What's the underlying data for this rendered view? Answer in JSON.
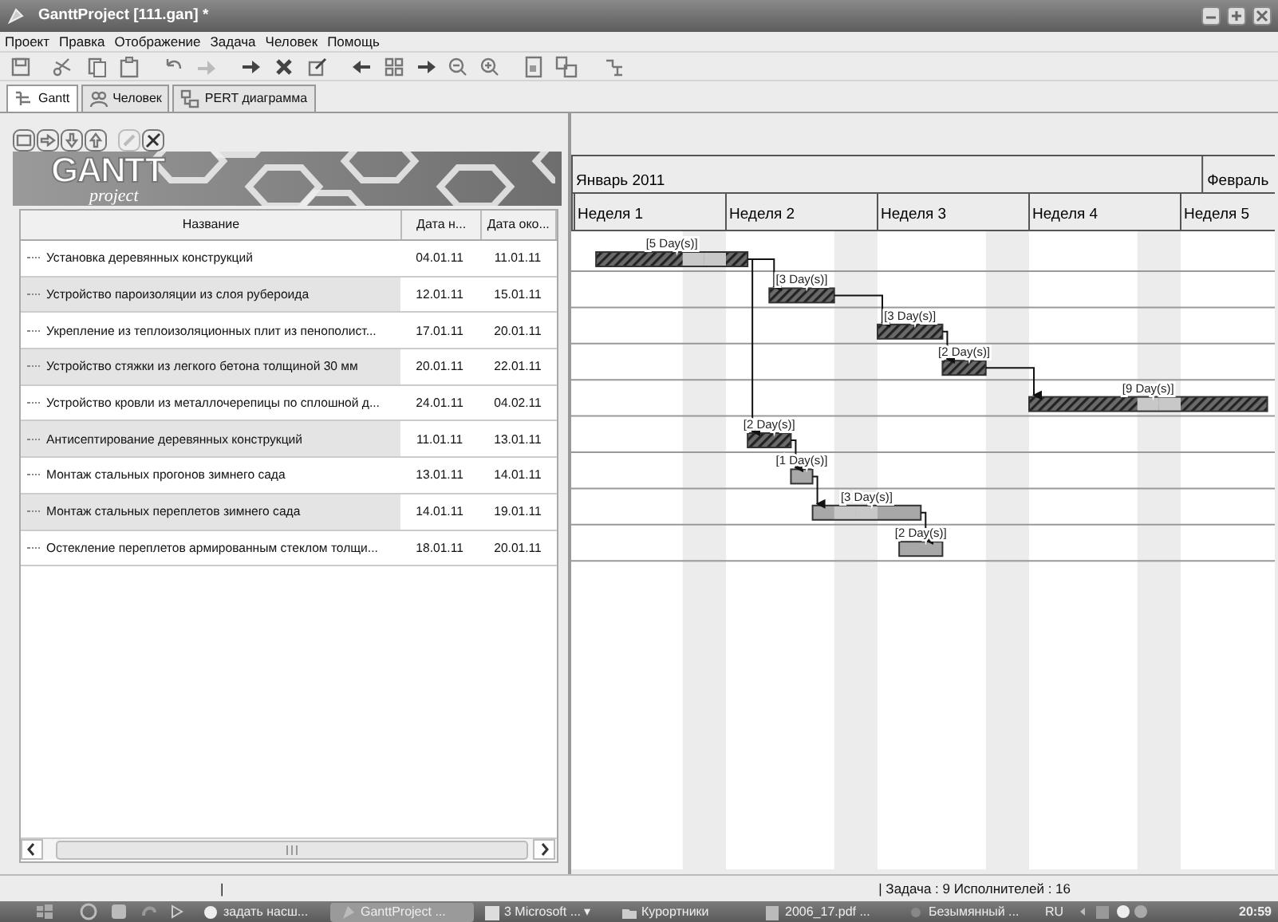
{
  "window": {
    "title": "GanttProject [111.gan] *"
  },
  "menu": [
    "Проект",
    "Правка",
    "Отображение",
    "Задача",
    "Человек",
    "Помощь"
  ],
  "tabs": [
    {
      "label": "Gantt",
      "selected": true
    },
    {
      "label": "Человек",
      "selected": false
    },
    {
      "label": "PERT диаграмма",
      "selected": false
    }
  ],
  "logo": {
    "title": "GANTT",
    "subtitle": "project"
  },
  "table": {
    "columns": [
      "Название",
      "Дата н...",
      "Дата око..."
    ]
  },
  "tasks": [
    {
      "name": "Установка деревянных конструкций",
      "start": "04.01.11",
      "end": "11.01.11",
      "bar_label": "[5 Day(s)]",
      "kind": "done"
    },
    {
      "name": "Устройство пароизоляции из слоя рубероида",
      "start": "12.01.11",
      "end": "15.01.11",
      "bar_label": "[3 Day(s)]",
      "kind": "done"
    },
    {
      "name": "Укрепление из теплоизоляционных плит из пенополист...",
      "start": "17.01.11",
      "end": "20.01.11",
      "bar_label": "[3 Day(s)]",
      "kind": "done"
    },
    {
      "name": "Устройство стяжки из легкого бетона толщиной 30 мм",
      "start": "20.01.11",
      "end": "22.01.11",
      "bar_label": "[2 Day(s)]",
      "kind": "done"
    },
    {
      "name": "Устройство кровли из металлочерепицы по сплошной д...",
      "start": "24.01.11",
      "end": "04.02.11",
      "bar_label": "[9 Day(s)]",
      "kind": "done"
    },
    {
      "name": "Антисептирование деревянных конструкций",
      "start": "11.01.11",
      "end": "13.01.11",
      "bar_label": "[2 Day(s)]",
      "kind": "done"
    },
    {
      "name": "Монтаж стальных прогонов зимнего сада",
      "start": "13.01.11",
      "end": "14.01.11",
      "bar_label": "[1 Day(s)]",
      "kind": "planned"
    },
    {
      "name": "Монтаж стальных переплетов зимнего сада",
      "start": "14.01.11",
      "end": "19.01.11",
      "bar_label": "[3 Day(s)]",
      "kind": "planned"
    },
    {
      "name": "Остекление переплетов армированным стеклом толщи...",
      "start": "18.01.11",
      "end": "20.01.11",
      "bar_label": "[2 Day(s)]",
      "kind": "planned"
    }
  ],
  "timeline": {
    "months": [
      "Январь 2011",
      "Февраль"
    ],
    "weeks": [
      "Неделя 1",
      "Неделя 2",
      "Неделя 3",
      "Неделя 4",
      "Неделя 5"
    ]
  },
  "status_bar": {
    "left": "|",
    "right": "| Задача : 9  Исполнителей : 16"
  },
  "taskbar": {
    "buttons": [
      {
        "label": "задать насш...",
        "selected": false
      },
      {
        "label": "GanttProject ...",
        "selected": true
      },
      {
        "label": "3 Microsoft ... ▾",
        "selected": false
      },
      {
        "label": "Курортники",
        "selected": false
      },
      {
        "label": "2006_17.pdf ...",
        "selected": false
      },
      {
        "label": "Безымянный ...",
        "selected": false
      }
    ],
    "language": "RU",
    "clock": "20:59"
  }
}
